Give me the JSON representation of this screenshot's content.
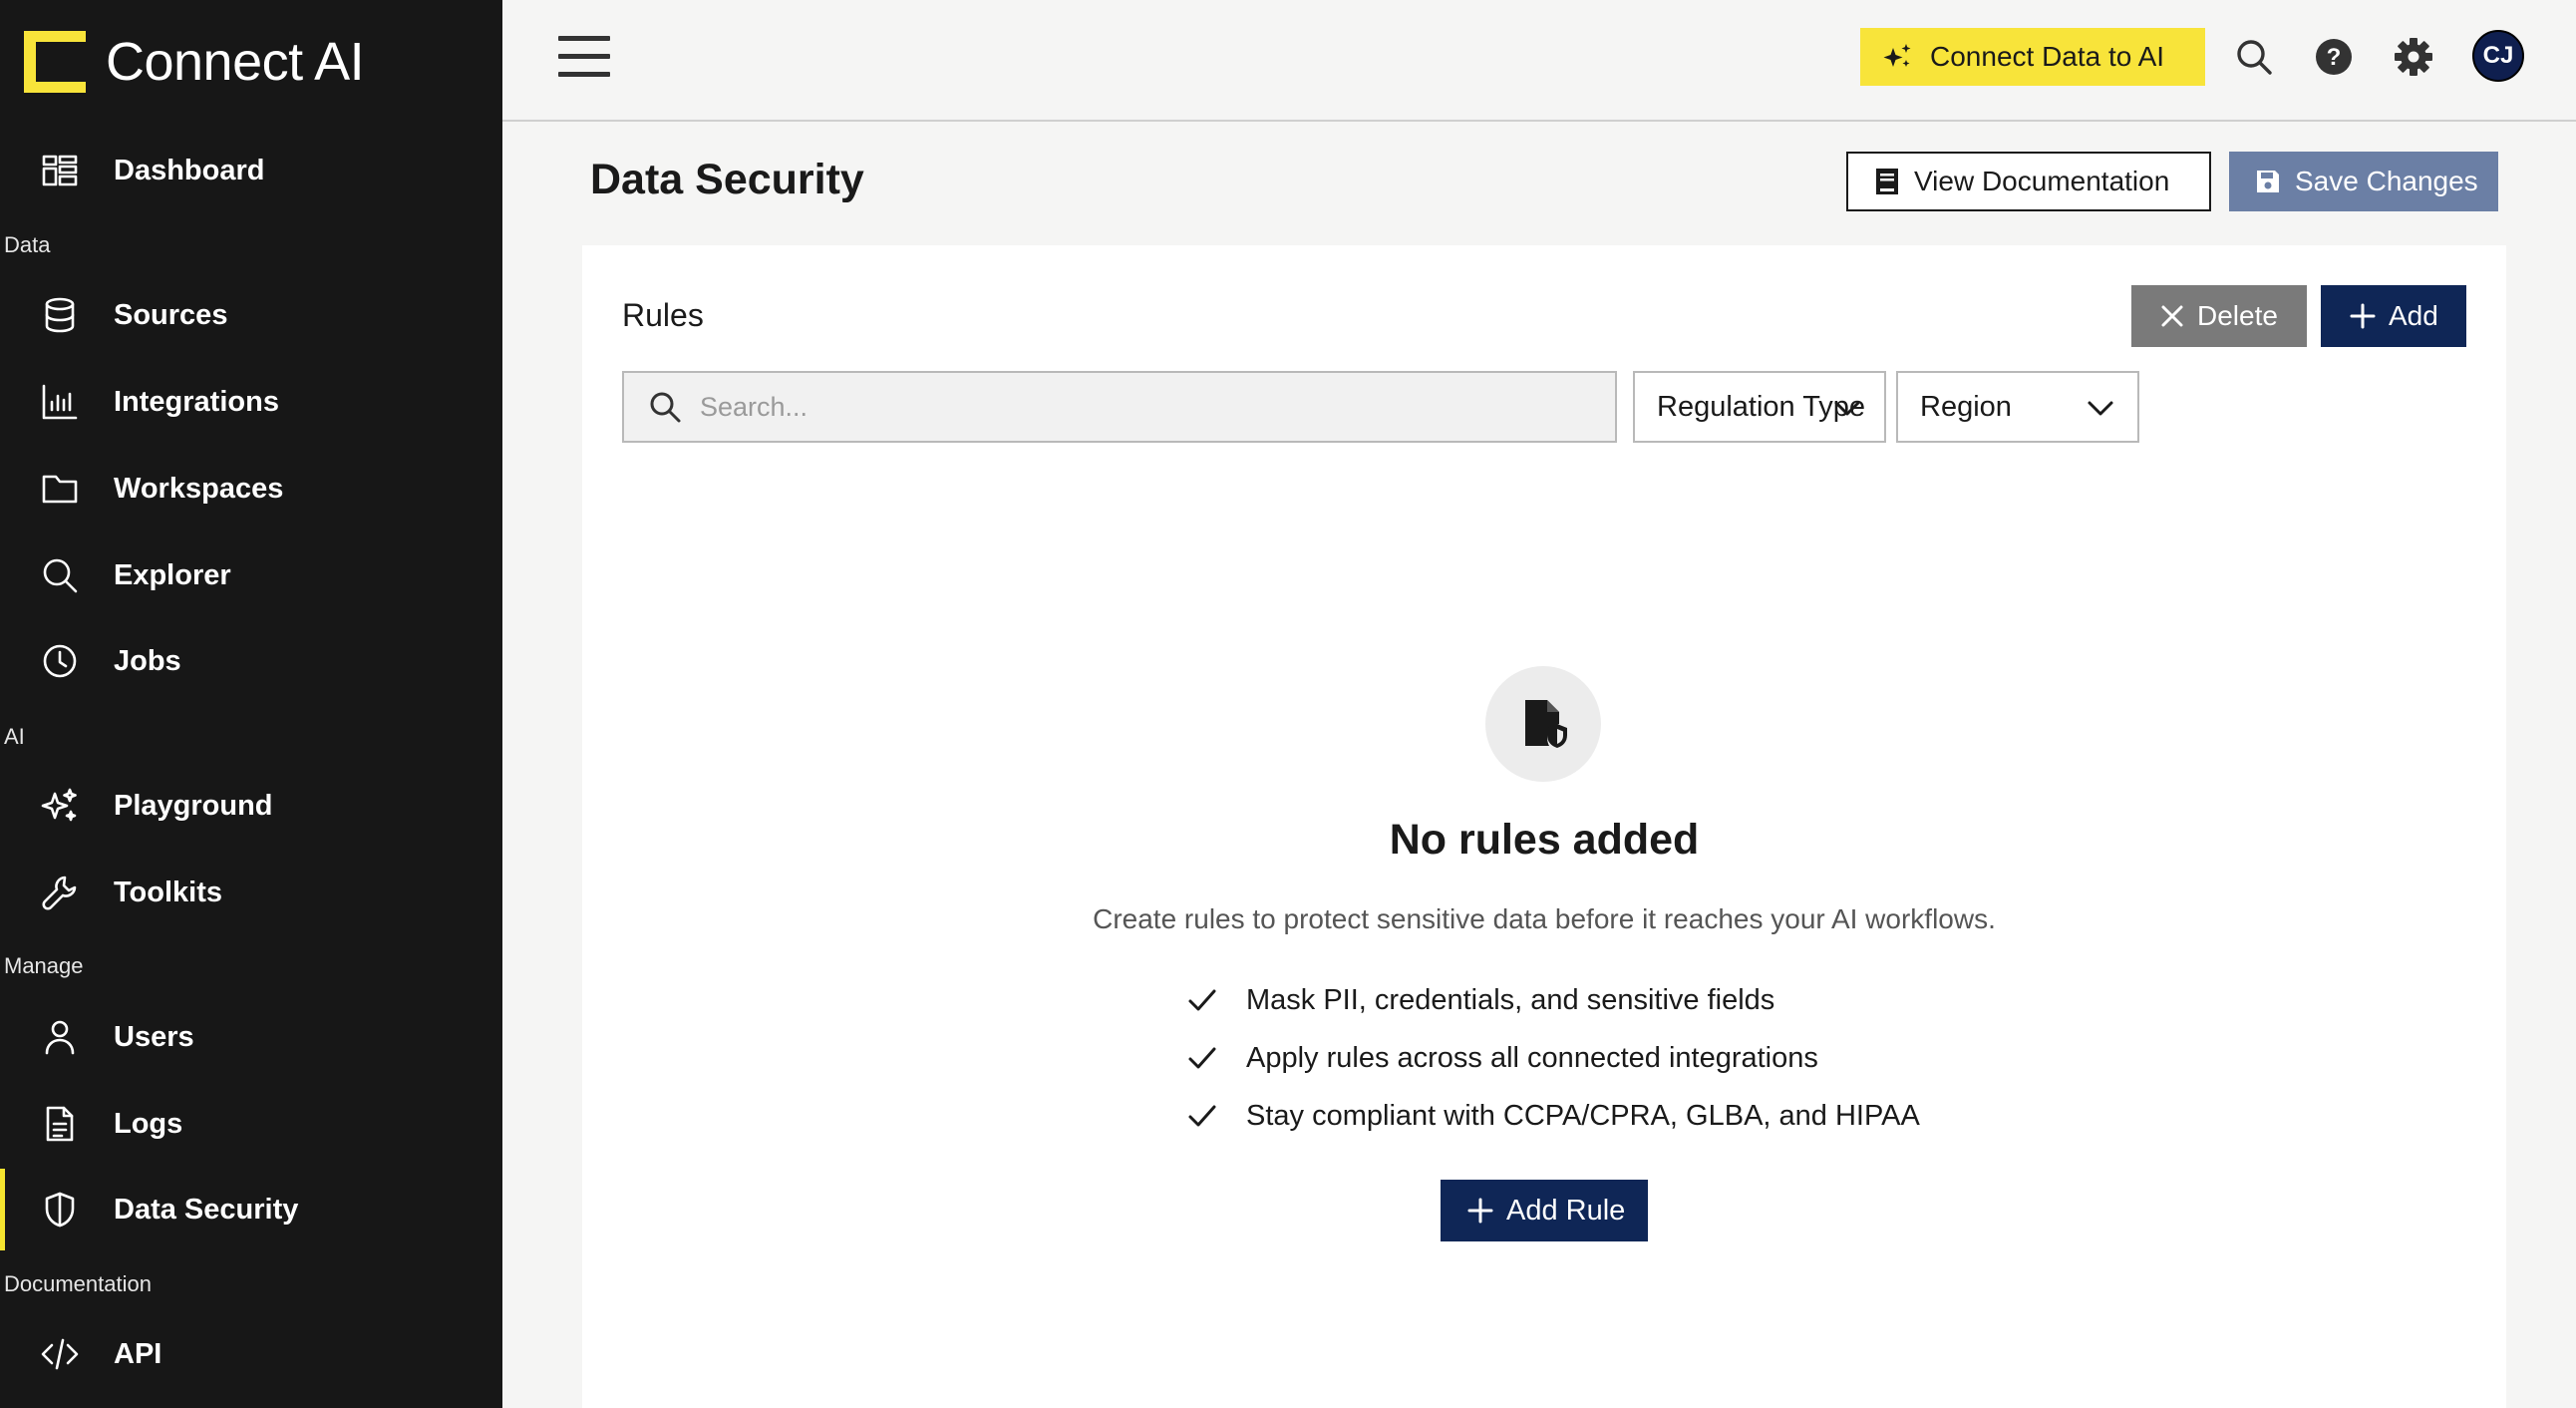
{
  "app": {
    "title": "Connect AI",
    "accent_color": "#f8e43a",
    "navy_color": "#0f2656"
  },
  "sidebar": {
    "sections": {
      "data": "Data",
      "ai": "AI",
      "manage": "Manage",
      "documentation": "Documentation"
    },
    "items": {
      "dashboard": {
        "label": "Dashboard",
        "icon": "dashboard-icon"
      },
      "sources": {
        "label": "Sources",
        "icon": "database-icon"
      },
      "integrations": {
        "label": "Integrations",
        "icon": "bar-chart-icon"
      },
      "workspaces": {
        "label": "Workspaces",
        "icon": "folder-icon"
      },
      "explorer": {
        "label": "Explorer",
        "icon": "search-icon"
      },
      "jobs": {
        "label": "Jobs",
        "icon": "clock-icon"
      },
      "playground": {
        "label": "Playground",
        "icon": "sparkle-icon"
      },
      "toolkits": {
        "label": "Toolkits",
        "icon": "wrench-icon"
      },
      "users": {
        "label": "Users",
        "icon": "user-icon"
      },
      "logs": {
        "label": "Logs",
        "icon": "document-icon"
      },
      "data_security": {
        "label": "Data Security",
        "icon": "shield-icon",
        "active": true
      },
      "api": {
        "label": "API",
        "icon": "code-icon"
      }
    }
  },
  "header": {
    "connect_button": "Connect Data to AI",
    "avatar_initials": "CJ"
  },
  "page": {
    "title": "Data Security",
    "view_docs": "View Documentation",
    "save_changes": "Save Changes"
  },
  "rules": {
    "title": "Rules",
    "delete_label": "Delete",
    "add_label": "Add",
    "search_placeholder": "Search...",
    "regulation_select": "Regulation Type",
    "region_select": "Region",
    "empty": {
      "title": "No rules added",
      "subtitle": "Create rules to protect sensitive data before it reaches your AI workflows.",
      "checks": [
        "Mask PII, credentials, and sensitive fields",
        "Apply rules across all connected integrations",
        "Stay compliant with CCPA/CPRA, GLBA, and HIPAA"
      ],
      "add_rule": "Add Rule"
    }
  }
}
